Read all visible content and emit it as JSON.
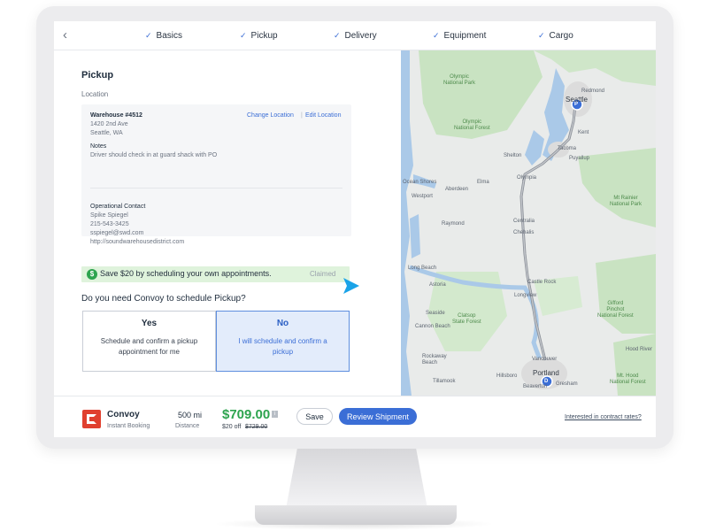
{
  "steps": [
    {
      "label": "Basics"
    },
    {
      "label": "Pickup"
    },
    {
      "label": "Delivery"
    },
    {
      "label": "Equipment"
    },
    {
      "label": "Cargo"
    }
  ],
  "icons": {
    "back": "chevron-left-icon",
    "check": "check-icon",
    "dollar": "dollar-circle-icon",
    "cursor": "pointer-cursor-icon",
    "info": "info-icon",
    "logo": "convoy-logo"
  },
  "pickup": {
    "title": "Pickup",
    "location_label": "Location",
    "warehouse_name": "Warehouse #4512",
    "address_line1": "1420 2nd Ave",
    "address_line2": "Seattle, WA",
    "change_location": "Change Location",
    "link_separator": "|",
    "edit_location": "Edit Location",
    "notes_label": "Notes",
    "notes_text": "Driver should check in at guard shack with PO",
    "contact_label": "Operational Contact",
    "contact_name": "Spike Spiegel",
    "contact_phone": "215-543-3425",
    "contact_email": "sspiegel@swd.com",
    "contact_url": "http://soundwarehousedistrict.com"
  },
  "promo": {
    "icon_glyph": "$",
    "text": "Save $20 by scheduling your own appointments.",
    "status": "Claimed"
  },
  "question": "Do you need Convoy to schedule Pickup?",
  "options": {
    "yes": {
      "title": "Yes",
      "desc": "Schedule and confirm a pickup appointment for me"
    },
    "no": {
      "title": "No",
      "desc": "I will schedule and confirm a pickup",
      "selected": true
    }
  },
  "map": {
    "labels": {
      "olympic_np": "Olympic\nNational Park",
      "redmond": "Redmond",
      "seattle": "Seattle",
      "olympic_nf": "Olympic\nNational Forest",
      "kent": "Kent",
      "tacoma": "Tacoma",
      "shelton": "Shelton",
      "puyallup": "Puyallup",
      "ocean_shores": "Ocean Shores",
      "aberdeen": "Aberdeen",
      "elma": "Elma",
      "olympia": "Olympia",
      "mt_rainier": "Mt Rainier\nNational Park",
      "westport": "Westport",
      "raymond": "Raymond",
      "centralia": "Centralia",
      "chehalis": "Chehalis",
      "long_beach": "Long Beach",
      "astoria": "Astoria",
      "castle_rock": "Castle Rock",
      "longview": "Longview",
      "seaside": "Seaside",
      "clatsop": "Clatsop\nState Forest",
      "cannon_beach": "Cannon Beach",
      "gifford": "Gifford\nPinchot\nNational Forest",
      "vancouver": "Vancouver",
      "rockaway": "Rockaway\nBeach",
      "tillamook": "Tillamook",
      "hillsboro": "Hillsboro",
      "portland": "Portland",
      "gresham": "Gresham",
      "beaverton": "Beaverton",
      "hood_river": "Hood River",
      "mt_hood": "Mt. Hood\nNational Forest"
    },
    "pin_pickup": "P",
    "pin_delivery": "D"
  },
  "footer": {
    "brand": "Convoy",
    "booking": "Instant Booking",
    "distance_value": "500 mi",
    "distance_label": "Distance",
    "price": "$709.00",
    "info_glyph": "i",
    "discount": "$20 off",
    "original_price": "$729.00",
    "save_label": "Save",
    "review_label": "Review Shipment",
    "contract_link": "Interested in contract rates?"
  },
  "colors": {
    "accent": "#3b6ed6",
    "price_green": "#2ea44f",
    "promo_bg": "#dff3dc",
    "logo_red": "#e0402f"
  }
}
